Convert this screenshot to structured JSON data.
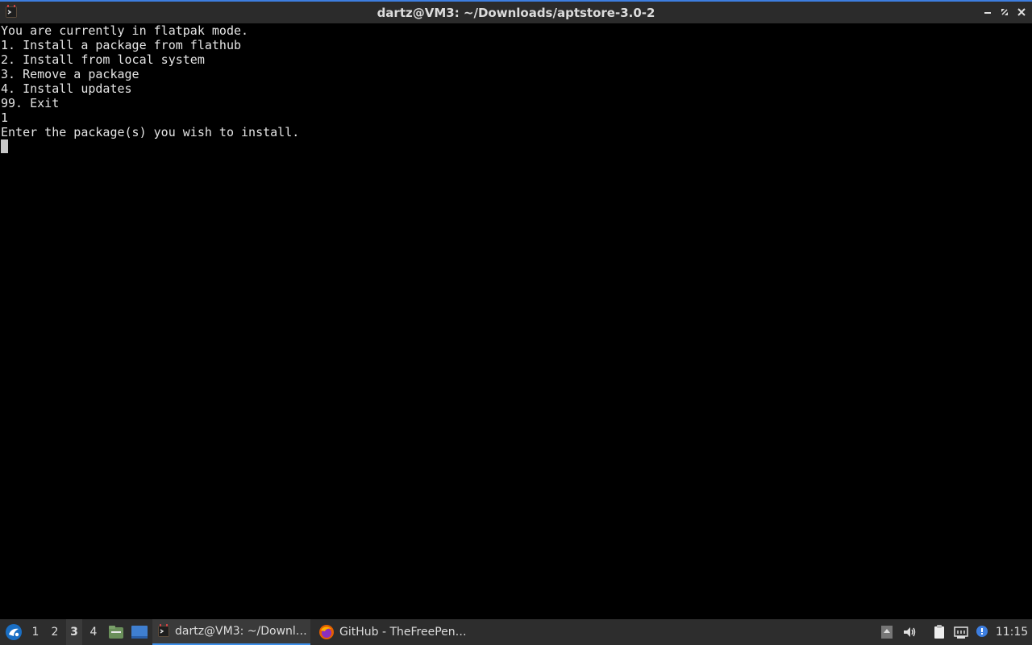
{
  "window": {
    "title": "dartz@VM3: ~/Downloads/aptstore-3.0-2"
  },
  "terminal": {
    "lines": [
      "You are currently in flatpak mode.",
      "1. Install a package from flathub",
      "2. Install from local system",
      "3. Remove a package",
      "4. Install updates",
      "99. Exit",
      "1",
      "Enter the package(s) you wish to install."
    ]
  },
  "taskbar": {
    "workspaces": [
      "1",
      "2",
      "3",
      "4"
    ],
    "active_workspace": "3",
    "tasks": [
      {
        "label": "dartz@VM3: ~/Downl…",
        "icon": "terminal-icon",
        "active": true
      },
      {
        "label": "GitHub - TheFreePen…",
        "icon": "firefox-icon",
        "active": false
      }
    ],
    "clock": "11:15",
    "tray_icons": [
      "show-desktop-icon",
      "volume-icon",
      "clipboard-icon",
      "network-icon",
      "update-notifier-icon"
    ]
  },
  "colors": {
    "accent": "#3d8ee8",
    "terminal_bg": "#000000",
    "terminal_fg": "#e5e5e5",
    "panel_bg": "#2d2d2d"
  }
}
